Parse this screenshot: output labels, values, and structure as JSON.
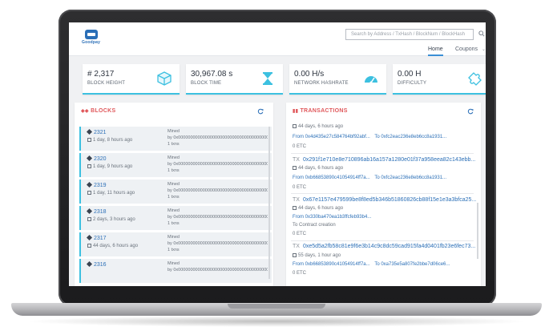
{
  "header": {
    "logo_text": "Goodpay",
    "search_placeholder": "Search by Address / TxHash / BlockNum / BlockHash",
    "nav": {
      "home": "Home",
      "coupons": "Coupons"
    }
  },
  "stats": [
    {
      "value": "# 2,317",
      "label": "BLOCK HEIGHT",
      "icon": "cube-icon"
    },
    {
      "value": "30,967.08 s",
      "label": "BLOCK TIME",
      "icon": "hourglass-icon"
    },
    {
      "value": "0.00 H/s",
      "label": "NETWORK HASHRATE",
      "icon": "gauge-icon"
    },
    {
      "value": "0.00 H",
      "label": "DIFFICULTY",
      "icon": "puzzle-icon"
    }
  ],
  "blocks_panel": {
    "title": "BLOCKS",
    "rows": [
      {
        "num": "2321",
        "age": "1 day, 8 hours ago",
        "mined": "Mined",
        "by": "by 0x0000000000000000000000000000000000000000",
        "tx": "1 txns"
      },
      {
        "num": "2320",
        "age": "1 day, 9 hours ago",
        "mined": "Mined",
        "by": "by 0x0000000000000000000000000000000000000000",
        "tx": "1 txns"
      },
      {
        "num": "2319",
        "age": "1 day, 11 hours ago",
        "mined": "Mined",
        "by": "by 0x0000000000000000000000000000000000000000",
        "tx": "1 txns"
      },
      {
        "num": "2318",
        "age": "2 days, 3 hours ago",
        "mined": "Mined",
        "by": "by 0x0000000000000000000000000000000000000000",
        "tx": "1 txns"
      },
      {
        "num": "2317",
        "age": "44 days, 6 hours ago",
        "mined": "Mined",
        "by": "by 0x0000000000000000000000000000000000000000",
        "tx": "1 txns"
      },
      {
        "num": "2316",
        "age": "",
        "mined": "Mined",
        "by": "by 0x0000000000000000000000000000000000000000",
        "tx": ""
      }
    ]
  },
  "tx_panel": {
    "title": "TRANSACTIONS",
    "top_partial": {
      "age": "44 days, 6 hours ago",
      "from": "From 0x4d435e27c584764bf92abf...",
      "to": "To 0xfc2eac236e8eb6cc8a1931...",
      "amount": "0 ETC"
    },
    "items": [
      {
        "prefix": "TX",
        "hash": "0x291f1e710e8e710896ab16a157a1280e01f37a958eea82c143ebb...",
        "age": "44 days, 6 hours ago",
        "from": "From 0xb66853890c41054914ff7a...",
        "to": "To 0xfc2eac236e8eb6cc8a1931...",
        "amount": "0 ETC"
      },
      {
        "prefix": "TX",
        "hash": "0x67e1157e479599be8f8ed5b346b51860826cb88f15e1e3a3bfca25...",
        "age": "44 days, 6 hours ago",
        "from": "From 0x330ba470ea1b3ffcfeb93b4...",
        "to": "To Contract creation",
        "amount": "0 ETC"
      },
      {
        "prefix": "TX",
        "hash": "0xe5d5a2fb58c81e9f6e3b14c9c8dc59cad915fa4d0401fb23e6fec73...",
        "age": "55 days, 1 hour ago",
        "from": "From 0xb66853890c41054914ff7a...",
        "to": "To 0xa735e5a807fe2bbe7d06ce6...",
        "amount": "0 ETC"
      }
    ]
  },
  "colors": {
    "accent": "#3cc0e0",
    "title_red": "#e0585b",
    "link": "#2b6fb7"
  }
}
